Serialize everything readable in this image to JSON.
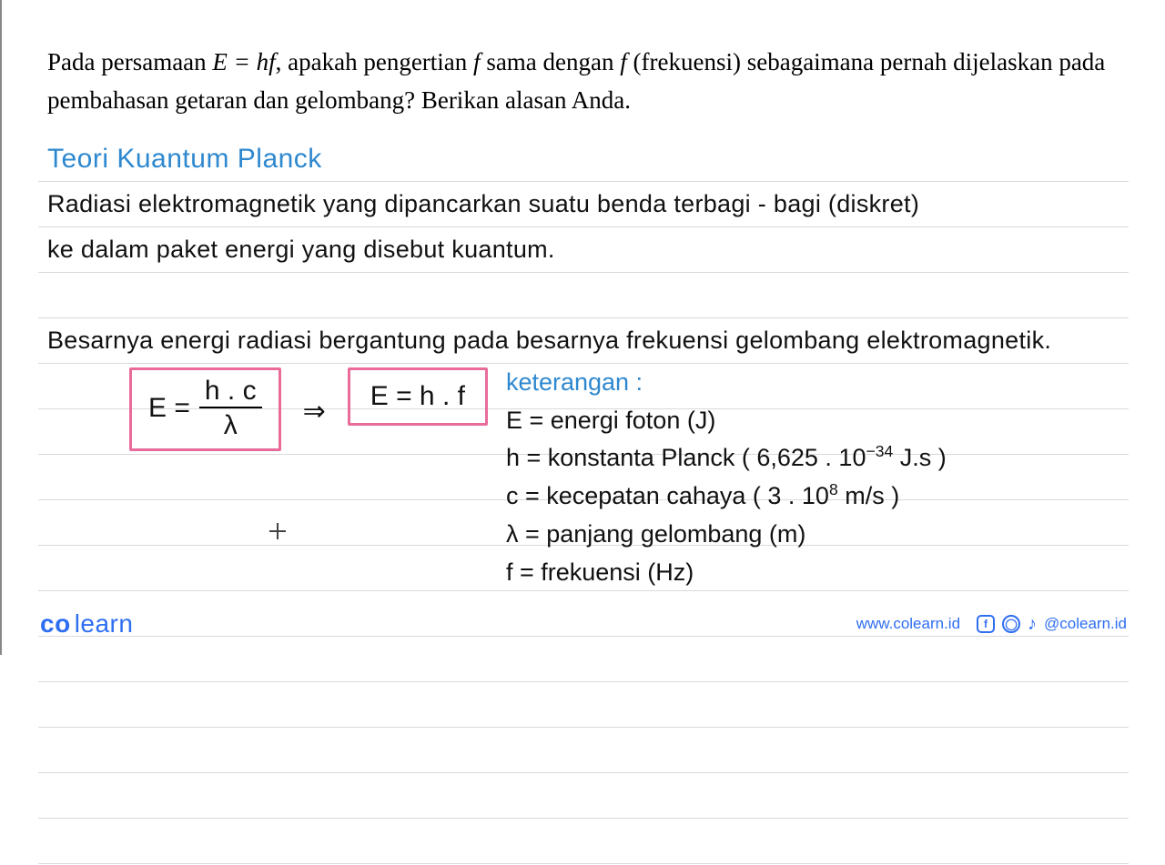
{
  "question": {
    "prefix": "Pada persamaan ",
    "eq": "E = hf",
    "mid1": ", apakah pengertian ",
    "fital1": "f",
    "mid2": " sama dengan ",
    "fital2": "f",
    "mid3": " (frekuensi) sebagaimana pernah dijelaskan pada pembahasan getaran dan gelombang? Berikan alasan Anda."
  },
  "notes": {
    "title": "Teori  Kuantum  Planck",
    "line1": "Radiasi  elektromagnetik  yang  dipancarkan  suatu  benda  terbagi - bagi   (diskret)",
    "line2": "ke  dalam  paket  energi  yang  disebut  kuantum.",
    "line3": "Besarnya  energi  radiasi  bergantung  pada  besarnya  frekuensi  gelombang  elektromagnetik."
  },
  "formulas": {
    "box1": {
      "lhs": "E =",
      "num": "h . c",
      "den": "λ"
    },
    "arrow": "⇒",
    "box2": "E  =  h . f"
  },
  "legend": {
    "heading": "keterangan :",
    "rows": {
      "E": "E  =  energi  foton   (J)",
      "h_pre": "h  =  konstanta  Planck  ( 6,625 . 10",
      "h_exp": "−34",
      "h_post": "  J.s )",
      "c_pre": "c  =  kecepatan  cahaya  ( 3 . 10",
      "c_exp": "8",
      "c_post": "  m/s )",
      "lambda": "λ  =  panjang  gelombang  (m)",
      "f": "f   =  frekuensi   (Hz)"
    }
  },
  "footer": {
    "logo1": "co",
    "logo2": "learn",
    "url": "www.colearn.id",
    "handle": "@colearn.id"
  }
}
